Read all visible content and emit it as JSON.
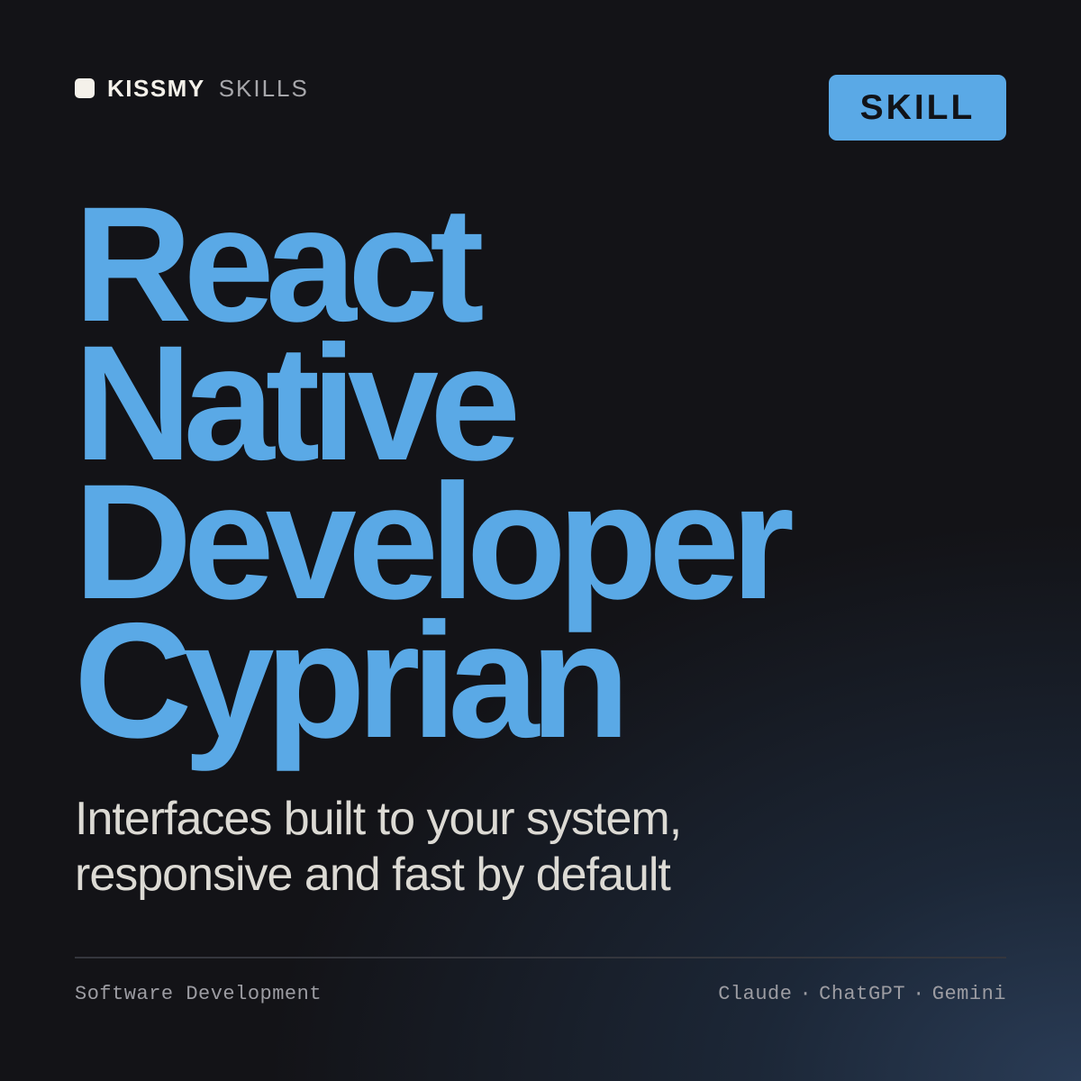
{
  "brand": {
    "name": "KISSMY",
    "sub": "SKILLS",
    "mark_color": "#f4f1ea"
  },
  "badge": {
    "label": "SKILL",
    "background": "#5aa9e6"
  },
  "title": {
    "lines": [
      "React",
      "Native",
      "Developer",
      "Cyprian"
    ],
    "color": "#5aa9e6"
  },
  "subtitle": {
    "lines": [
      "Interfaces built to your system,",
      "responsive and fast by default"
    ]
  },
  "footer": {
    "category": "Software Development",
    "platforms": [
      "Claude",
      "ChatGPT",
      "Gemini"
    ],
    "separator": "·"
  },
  "colors": {
    "background": "#131317",
    "accent": "#5aa9e6",
    "text_primary": "#f4f1ea",
    "text_muted": "#9c9ca2"
  }
}
